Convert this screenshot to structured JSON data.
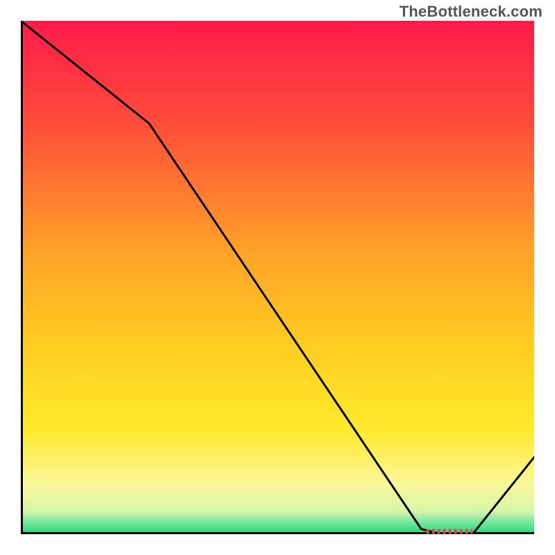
{
  "watermark": "TheBottleneck.com",
  "chart_data": {
    "type": "line",
    "title": "",
    "xlabel": "",
    "ylabel": "",
    "xlim": [
      0,
      100
    ],
    "ylim": [
      0,
      100
    ],
    "x": [
      0,
      25,
      78,
      82,
      88,
      100
    ],
    "values": [
      100,
      80,
      1,
      0,
      0,
      15
    ],
    "marker": {
      "x_start": 79,
      "x_end": 88,
      "y": 0,
      "color": "#d94a4a"
    },
    "gradient_stops": [
      {
        "offset": 0.0,
        "color": "#ff1a4a"
      },
      {
        "offset": 0.2,
        "color": "#ff4d3a"
      },
      {
        "offset": 0.45,
        "color": "#ffa328"
      },
      {
        "offset": 0.65,
        "color": "#ffd022"
      },
      {
        "offset": 0.8,
        "color": "#ffea2e"
      },
      {
        "offset": 0.9,
        "color": "#fbf79a"
      },
      {
        "offset": 0.955,
        "color": "#d9f5a8"
      },
      {
        "offset": 0.975,
        "color": "#7de8a0"
      },
      {
        "offset": 1.0,
        "color": "#1fd877"
      }
    ]
  }
}
